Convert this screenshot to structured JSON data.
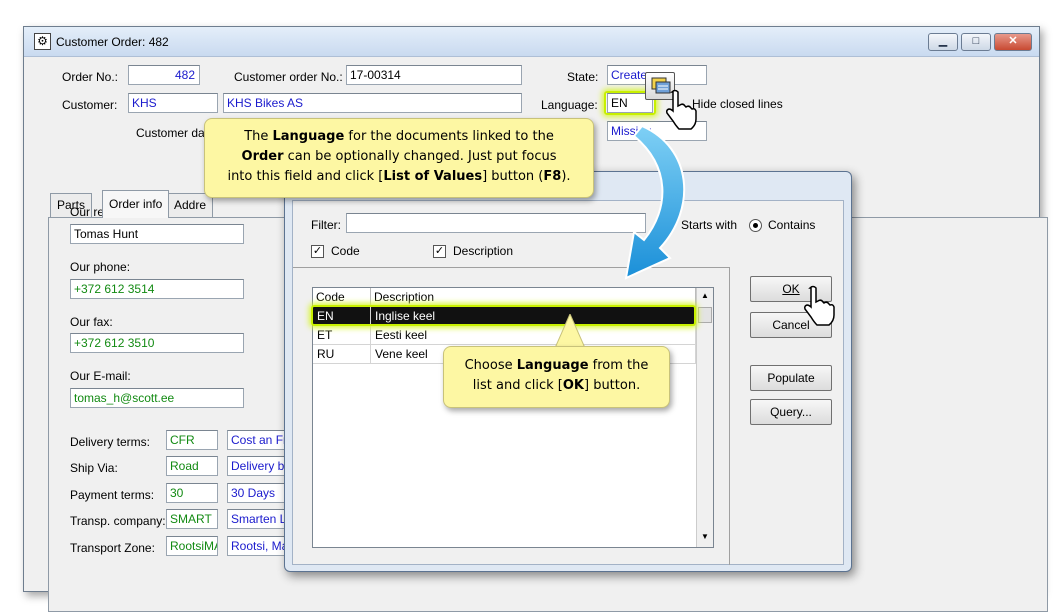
{
  "window": {
    "title": "Customer Order: 482",
    "min_label": "▁",
    "max_label": "□",
    "close_label": "✕"
  },
  "header": {
    "order_no_label": "Order No.:",
    "order_no_value": "482",
    "customer_order_no_label": "Customer order No.:",
    "customer_order_no_value": "17-00314",
    "state_label": "State:",
    "state_value": "Create",
    "customer_label": "Customer:",
    "customer_code": "KHS",
    "customer_name": "KHS Bikes AS",
    "language_label": "Language:",
    "language_value": "EN",
    "hide_closed_label": "Hide closed lines",
    "customer_date_label": "Customer dat",
    "missing_value": "Missing"
  },
  "tabs": [
    {
      "label": "Parts"
    },
    {
      "label": "Order info"
    },
    {
      "label": "Addre"
    }
  ],
  "order_info": {
    "our_reference_label": "Our reference:",
    "our_reference_value": "Tomas Hunt",
    "our_phone_label": "Our phone:",
    "our_phone_value": "+372 612 3514",
    "our_fax_label": "Our fax:",
    "our_fax_value": "+372 612 3510",
    "our_email_label": "Our E-mail:",
    "our_email_value": "tomas_h@scott.ee",
    "rows": [
      {
        "label": "Delivery terms:",
        "code": "CFR",
        "desc": "Cost an Fr"
      },
      {
        "label": "Ship Via:",
        "code": "Road",
        "desc": "Delivery by"
      },
      {
        "label": "Payment terms:",
        "code": "30",
        "desc": "30 Days"
      },
      {
        "label": "Transp. company:",
        "code": "SMART",
        "desc": "Smarten L"
      },
      {
        "label": "Transport Zone:",
        "code": "RootsiMA",
        "desc": "Rootsi, Ma"
      }
    ]
  },
  "lov_dialog": {
    "filter_label": "Filter:",
    "filter_value": "",
    "code_checkbox_label": "Code",
    "description_checkbox_label": "Description",
    "starts_with_label": "Starts with",
    "contains_label": "Contains",
    "columns": [
      "Code",
      "Description"
    ],
    "rows": [
      {
        "code": "EN",
        "description": "Inglise keel"
      },
      {
        "code": "ET",
        "description": "Eesti keel"
      },
      {
        "code": "RU",
        "description": "Vene keel"
      }
    ],
    "ok_label": "OK",
    "cancel_label": "Cancel",
    "populate_label": "Populate",
    "query_label": "Query..."
  },
  "callouts": {
    "top": {
      "p1": "The ",
      "b1": "Language",
      "p2": " for the documents linked to the",
      "b2": "Order",
      "p3": " can be optionally changed.  Just put focus",
      "p4": "into this field and click [",
      "b3": "List of Values",
      "p5": "] button (",
      "b4": "F8",
      "p6": ")."
    },
    "bottom": {
      "p1": "Choose ",
      "b1": "Language",
      "p2": " from the",
      "p3": "list and click [",
      "b2": "OK",
      "p4": "] button."
    }
  },
  "colors": {
    "accent_highlight": "#c8f000",
    "callout_bg": "#fdf7a3",
    "arrow_blue": "#1aa3e8"
  }
}
